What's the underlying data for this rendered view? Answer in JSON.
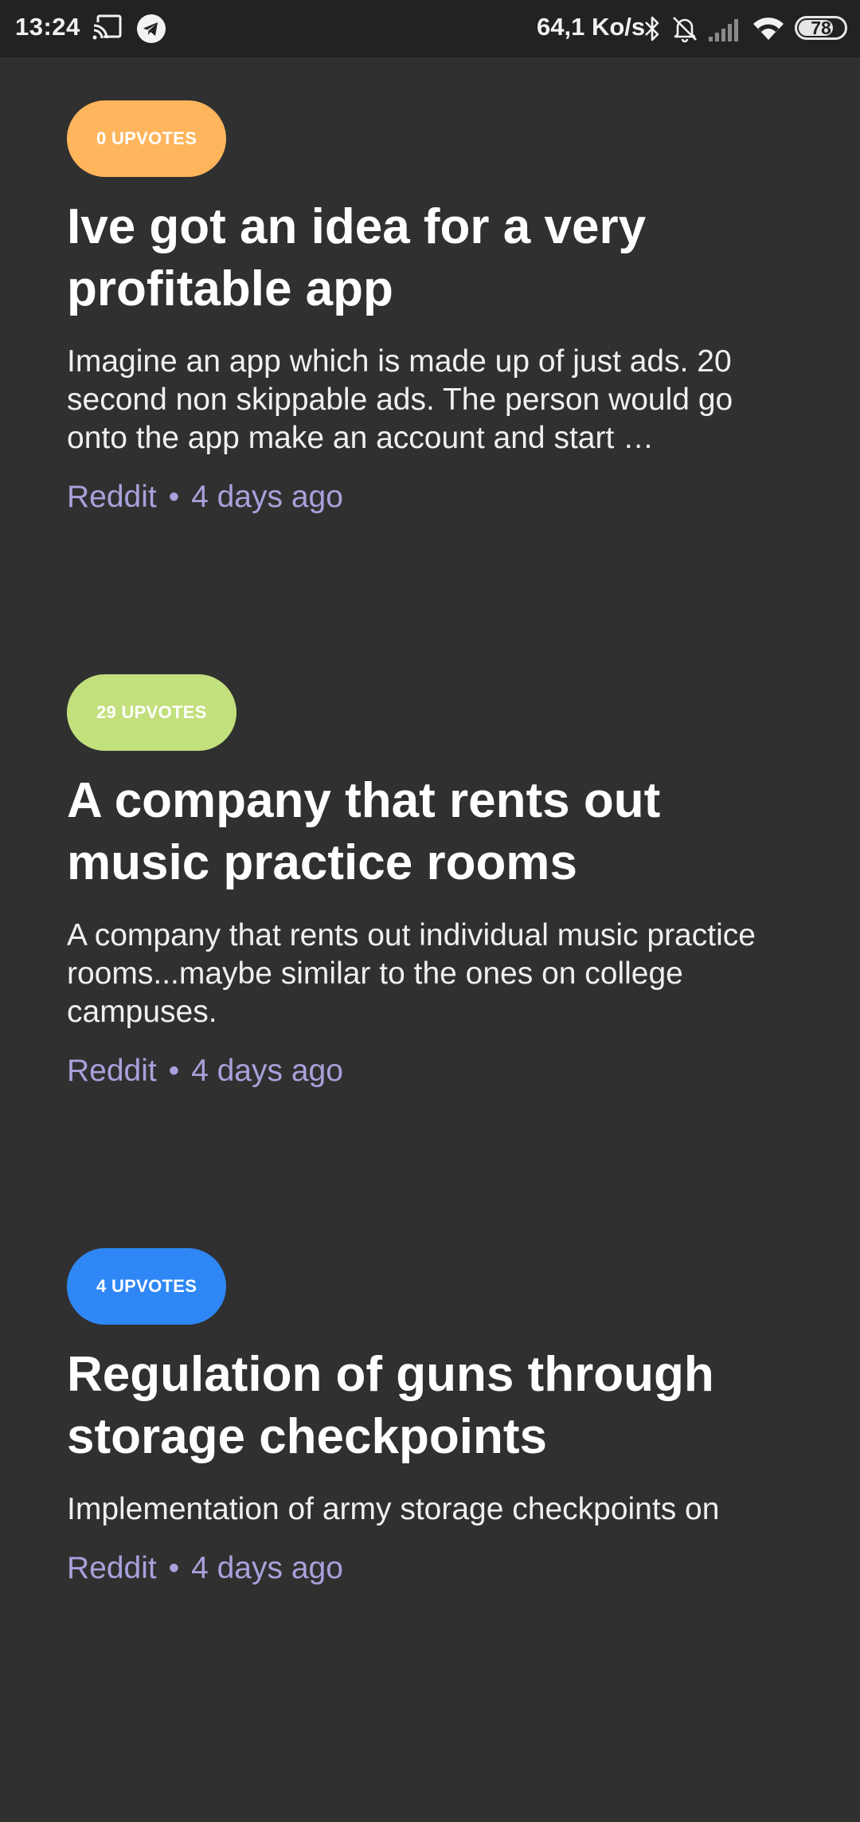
{
  "status_bar": {
    "time": "13:24",
    "speed": "64,1 Ko/s",
    "battery": "78",
    "battery_level_percent": 78,
    "icons": [
      "cast-icon",
      "telegram-icon",
      "bluetooth-icon",
      "notifications-off-icon",
      "signal-icon",
      "wifi-icon",
      "battery-icon"
    ]
  },
  "posts": [
    {
      "badge": "0 UPVOTES",
      "badge_color": "#FFB55C",
      "title": "Ive got an idea for a very profitable app",
      "body": "Imagine an app which is made up of just ads. 20 second non skippable ads. The person would go onto the app make an account and start …",
      "source": "Reddit",
      "separator": "•",
      "time": "4 days ago"
    },
    {
      "badge": "29 UPVOTES",
      "badge_color": "#C2E07C",
      "title": "A company that rents out music practice rooms",
      "body": "A company that rents out individual music practice rooms...maybe similar to the ones on college campuses.",
      "source": "Reddit",
      "separator": "•",
      "time": "4 days ago"
    },
    {
      "badge": "4 UPVOTES",
      "badge_color": "#2F87F5",
      "title": "Regulation of guns through storage checkpoints",
      "body": "Implementation of army storage checkpoints on",
      "source": "Reddit",
      "separator": "•",
      "time": "4 days ago"
    }
  ],
  "colors": {
    "background": "#303030",
    "status_bar": "#222222",
    "meta_text": "#A7A2DB"
  }
}
